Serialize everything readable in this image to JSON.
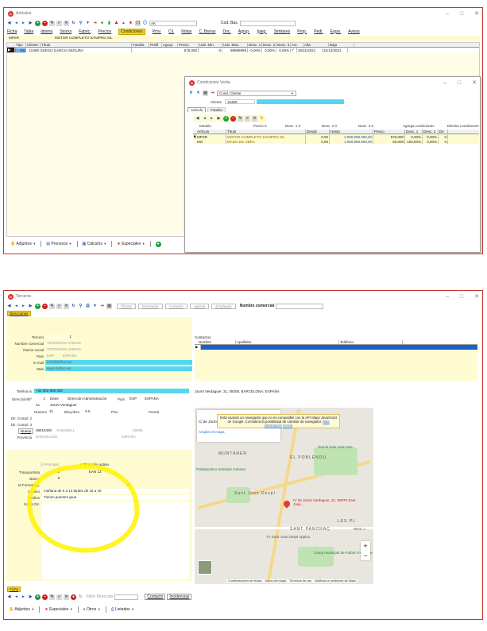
{
  "win1": {
    "title": "Artículos",
    "toolbar_search": "AK",
    "toolbar_cod": "Cod. Bas.",
    "menu": [
      "Ficha",
      "Tabla",
      "Idioma",
      "Stocks",
      "Fabric.",
      "Precios",
      "Condiciones",
      "Prov.",
      "Cli.",
      "Notas",
      "C. Barras",
      "Doc.",
      "Agrup.",
      "Ipaig.",
      "Similares",
      "Prop.",
      "Pedi.",
      "Equiv.",
      "Avisos"
    ],
    "active_menu": "Condiciones",
    "product_code": "MPSR",
    "product_name": "MOTOR COMPLETO SANIPRO SIL",
    "grid_headers": [
      "Tipo",
      "Cliente",
      "Título",
      "Familia",
      "Prefil",
      "Agrup.",
      "Precio",
      "Uds. Min.",
      "Uds. Max.",
      "Desc. 1",
      "Desc. 2",
      "Desc. 3",
      "Act.",
      "Alta",
      "Baja"
    ],
    "grid_row": {
      "tipo": "Cli.",
      "cliente": "10490",
      "titulo": "DIEGO GARCIA SEGURA",
      "precio": "576,000",
      "min": "0",
      "max": "99999999",
      "d1": "0,00%",
      "d2": "0,00%",
      "d3": "0,00%",
      "alta": "26/11/2021",
      "baja": "31/12/2021"
    },
    "bottom": [
      "Adjuntos",
      "Procesos",
      "Cálculos",
      "Especiales"
    ]
  },
  "cond": {
    "title": "Condiciones Venta",
    "combo": "Cond. Cliente",
    "cliente_label": "Cliente",
    "cliente_value": "10490",
    "tabs": [
      "Artículo",
      "Familia"
    ],
    "modelo_label": "Modelo",
    "precio_label": "Precio",
    "precio_value": "0",
    "desc1_label": "Desc. 1",
    "desc1_value": "0",
    "desc2_label": "Desc. 2",
    "desc2_value": "0",
    "desc3_label": "Desc. 3",
    "desc3_value": "0",
    "agrega": "Agrega condiciones",
    "elimina": "Elimina condiciones",
    "headers": [
      "Artículo",
      "Título",
      "Desde",
      "Hasta",
      "Precio",
      "Desc. 1",
      "Desc. 2",
      "De"
    ],
    "rows": [
      {
        "art": "MPSR",
        "tit": "MOTOR COMPLETO SANIPRO SIL",
        "desde": "0,00",
        "hasta": "1.999.999.999,00",
        "precio": "576,000",
        "d1": "0,00%",
        "d2": "0,00%",
        "d3": "0"
      },
      {
        "art": "MO",
        "tit": "MANO DE OBRA",
        "desde": "0,00",
        "hasta": "1.999.999.999,00",
        "precio": "50,000",
        "d1": "100,00%",
        "d2": "0,00%",
        "d3": "0"
      }
    ]
  },
  "win2": {
    "title": "Terceros",
    "toolbar_buttons": [
      "Cliente",
      "Proveedor",
      "Acreedor",
      "Agente",
      "Empleado"
    ],
    "nombre_comercial": "Nombre comercial",
    "tab": "Direcciones",
    "tercero_label": "Tercero",
    "tercero_value": "1",
    "nombre_label": "Nombre comercial",
    "nombre_value": "TERCEROS VARIOS",
    "razon_label": "Razón social",
    "razon_value": "TERCEROS VARIOS",
    "pais_label": "País",
    "pais_code": "ESP",
    "pais_name": "ESPAÑA",
    "email_label": "E-mail",
    "email_value": "info@delfos.net",
    "web_label": "Web",
    "web_value": "www.delfos.net",
    "contactos_label": "Contactos",
    "contact_headers": [
      "Nombre",
      "Apellidos",
      "Teléfono"
    ],
    "telefonos_label": "Teléfonos",
    "telefono_value": "+34 902 900 092",
    "address_line": "Jacint Verdaguer, 31, 08205, BARCELONA, ESPAÑA",
    "direccion_label": "Dirección/Nº",
    "dir_num": "1",
    "dir_tipo": "Dane",
    "dir_desc": "Dirección Administración",
    "dir_pais_label": "País",
    "dir_pais_code": "ESP",
    "dir_pais_name": "ESPAÑA",
    "via": "CL",
    "via_nombre": "Jacint Verdaguer",
    "numero_label": "Número",
    "numero_value": "31",
    "bloq_label": "Bloq./Esc.",
    "bloq_value": "2-5",
    "piso_label": "Piso",
    "puerta_label": "Puerta",
    "compl2_label": "Dir. Compl. 2",
    "compl3_label": "Dir. Compl. 3",
    "poblacion_btn": "Nueva",
    "cp": "08015400",
    "poblacion": "SABADELL",
    "cp2": "08205",
    "provincia_label": "Provincia",
    "provincia": "BARCELONA",
    "provincia_pais": "ESPAÑA",
    "principal": "Principal",
    "activa": "Dirección activa",
    "transportista_label": "Transportista",
    "transportista_value": "0",
    "ean": "EAN 13",
    "banco_label": "Banco",
    "banco_value": "0",
    "idforma_label": "Id FormaPag.",
    "idforma_value": "0",
    "horario_label": "Horario",
    "horario_value": "mañana de 9 a 13 tardes de 16 a 19",
    "medios_label": "Medios",
    "medios_value": "Tienen puentes grua",
    "notas_label": "Notas Dir.",
    "bottom_tab": "Ficha",
    "filtro": "Filtro Dirección",
    "contacto_btn": "Contacto",
    "incidencias_btn": "Incidencias",
    "bottom": [
      "Adjuntos",
      "Especiales",
      "Otros",
      "Listados"
    ]
  },
  "map": {
    "cdjacint": "C/ de Jacint Verdaguer, 31, 08970 Sant Joan...",
    "ampliar": "Ampliar el mapa",
    "warning": "Está usando un navegador que no es compatible con la API Maps JavaScript de Google. Considera la posibilidad de cambiar de navegador.",
    "mas_info": "Más información",
    "cerrar": "Cerrar",
    "labels": [
      "MUNTANER",
      "EL POBLENOU",
      "Polideportivo Salvador Gimeno",
      "Sant Joan Despí",
      "LES PL",
      "SANT PANCRAÇ",
      "REIG J",
      "Tennis Sant Joan Des",
      "Camp municipal de Futbol Fontsanta-Fatjó",
      "TV Sant Joan Despí Applus"
    ],
    "pin_label": "C/ de Jacint Verdaguer, 31, 08970 Sant Joan...",
    "footer": [
      "Combinaciones de teclas",
      "Datos del mapa",
      "Términos de uso",
      "Notificar un problema de Maps"
    ]
  }
}
